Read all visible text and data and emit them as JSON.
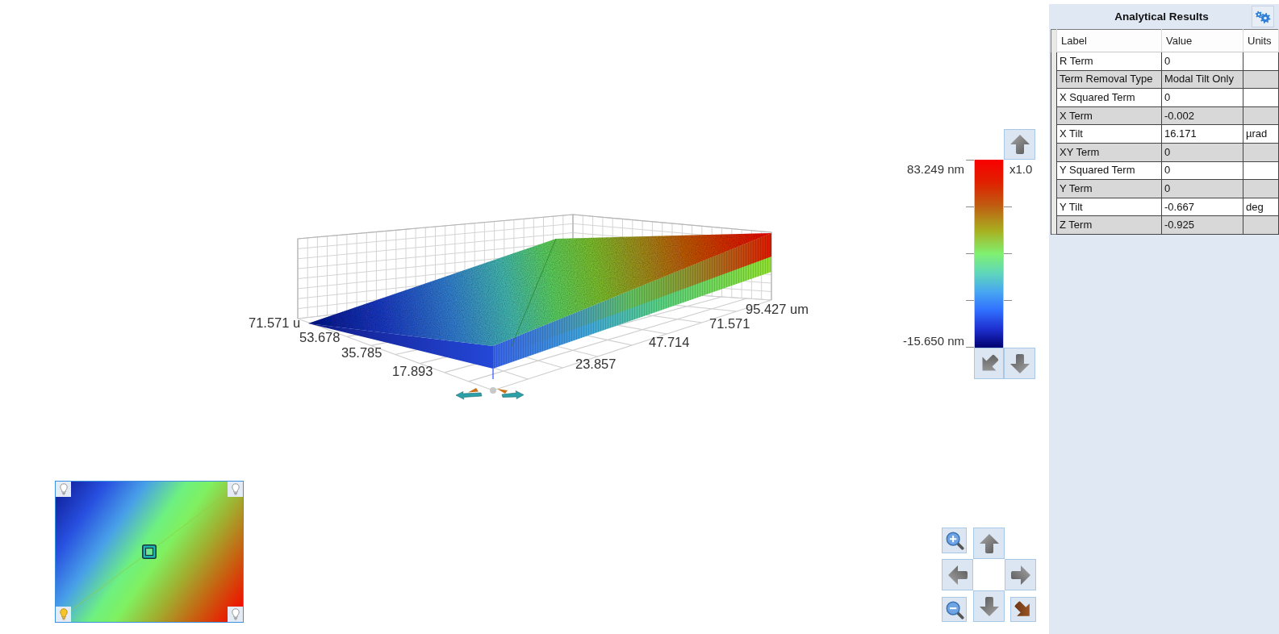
{
  "plot": {
    "x_axis_ticks": [
      "71.571 u",
      "53.678",
      "35.785",
      "17.893"
    ],
    "y_axis_ticks": [
      "23.857",
      "47.714",
      "71.571",
      "95.427 um"
    ]
  },
  "color_scale": {
    "max_label": "83.249 nm",
    "min_label": "-15.650 nm",
    "scale_factor": "x1.0"
  },
  "minimap": {
    "lights": [
      {
        "selected": false
      },
      {
        "selected": false
      },
      {
        "selected": true
      },
      {
        "selected": false
      }
    ]
  },
  "results_panel": {
    "title": "Analytical Results",
    "columns": [
      "Label",
      "Value",
      "Units"
    ],
    "rows": [
      {
        "label": "R Term",
        "value": "0"
      },
      {
        "label": "Term Removal Type",
        "value": "Modal Tilt Only"
      },
      {
        "label": "X Squared Term",
        "value": "0"
      },
      {
        "label": "X Term",
        "value": "-0.002"
      },
      {
        "label": "X Tilt",
        "value": "16.171",
        "units": "µrad"
      },
      {
        "label": "XY Term",
        "value": "0"
      },
      {
        "label": "Y Squared Term",
        "value": "0"
      },
      {
        "label": "Y Term",
        "value": "0"
      },
      {
        "label": "Y Tilt",
        "value": "-0.667",
        "units": "deg"
      },
      {
        "label": "Z Term",
        "value": "-0.925"
      }
    ]
  }
}
